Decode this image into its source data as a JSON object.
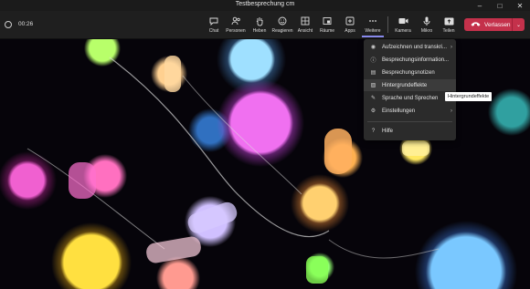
{
  "window": {
    "title": "Testbesprechung cm",
    "minimize": "–",
    "maximize": "□",
    "close": "✕"
  },
  "meeting": {
    "timer": "00:26"
  },
  "toolbar": {
    "buttons": [
      {
        "label": "Chat",
        "icon": "chat-icon"
      },
      {
        "label": "Personen",
        "icon": "people-icon"
      },
      {
        "label": "Heben",
        "icon": "raise-hand-icon"
      },
      {
        "label": "Reagieren",
        "icon": "smiley-icon"
      },
      {
        "label": "Ansicht",
        "icon": "view-icon"
      },
      {
        "label": "Räume",
        "icon": "rooms-icon"
      },
      {
        "label": "Apps",
        "icon": "apps-icon"
      },
      {
        "label": "Weitere",
        "icon": "more-icon"
      },
      {
        "label": "Kamera",
        "icon": "camera-icon"
      },
      {
        "label": "Mikro",
        "icon": "mic-icon"
      },
      {
        "label": "Teilen",
        "icon": "share-icon"
      }
    ],
    "leave_label": "Verlassen"
  },
  "more_menu": {
    "items": [
      {
        "label": "Aufzeichnen und transkri...",
        "icon": "record-icon",
        "has_submenu": true
      },
      {
        "label": "Besprechungsinformation...",
        "icon": "info-icon",
        "has_submenu": false
      },
      {
        "label": "Besprechungsnotizen",
        "icon": "notes-icon",
        "has_submenu": false
      },
      {
        "label": "Hintergrundeffekte",
        "icon": "background-effects-icon",
        "has_submenu": false
      },
      {
        "label": "Sprache und Sprechen",
        "icon": "language-icon",
        "has_submenu": true
      },
      {
        "label": "Einstellungen",
        "icon": "settings-icon",
        "has_submenu": true
      },
      {
        "label": "Hilfe",
        "icon": "help-icon",
        "has_submenu": false
      }
    ],
    "highlighted": "Hintergrundeffekte"
  },
  "tooltip": "Hintergrundeffekte",
  "colors": {
    "accent": "#8b8cf0",
    "leave": "#c4314b",
    "menu_bg": "#2b2b2b",
    "toolbar_bg": "#1f1f1f"
  }
}
